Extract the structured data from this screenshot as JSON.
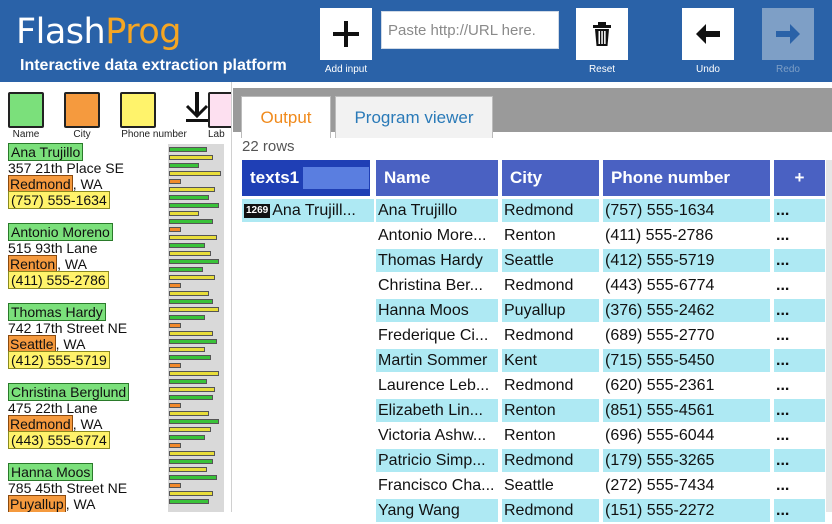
{
  "app": {
    "logo_main": "Flash",
    "logo_accent": "Prog",
    "tagline": "Interactive data extraction platform"
  },
  "toolbar": {
    "add_label": "Add input",
    "url_placeholder": "Paste http://URL here.",
    "reset_label": "Reset",
    "undo_label": "Undo",
    "redo_label": "Redo"
  },
  "legend": [
    {
      "label": "Name",
      "color": "#7be07b"
    },
    {
      "label": "City",
      "color": "#f59a3e"
    },
    {
      "label": "Phone number",
      "color": "#fff36b"
    },
    {
      "label": "Lab",
      "color": "#fde0f0"
    }
  ],
  "document": [
    {
      "name": "Ana Trujillo",
      "street": "357 21th Place SE",
      "city": "Redmond",
      "state": ", WA",
      "phone": "(757) 555-1634"
    },
    {
      "name": "Antonio Moreno",
      "street": "515 93th Lane",
      "city": "Renton",
      "state": ", WA",
      "phone": "(411) 555-2786"
    },
    {
      "name": "Thomas Hardy",
      "street": "742 17th Street NE",
      "city": "Seattle",
      "state": ", WA",
      "phone": "(412) 555-5719"
    },
    {
      "name": "Christina Berglund",
      "street": "475 22th Lane",
      "city": "Redmond",
      "state": ", WA",
      "phone": "(443) 555-6774"
    },
    {
      "name": "Hanna Moos",
      "street": "785 45th Street NE",
      "city": "Puyallup",
      "state": ", WA",
      "phone": ""
    }
  ],
  "tabs": {
    "output": "Output",
    "program": "Program viewer"
  },
  "output": {
    "rows_count": "22 rows",
    "columns": {
      "texts": "texts1",
      "name": "Name",
      "city": "City",
      "phone": "Phone number",
      "plus": "+"
    },
    "first_badge": "1269",
    "first_text": "Ana Trujill...",
    "rows": [
      {
        "name": "Ana Trujillo",
        "city": "Redmond",
        "phone": "(757) 555-1634",
        "more": "...",
        "hl": true
      },
      {
        "name": "Antonio More...",
        "city": "Renton",
        "phone": "(411) 555-2786",
        "more": "...",
        "hl": false
      },
      {
        "name": "Thomas Hardy",
        "city": "Seattle",
        "phone": "(412) 555-5719",
        "more": "...",
        "hl": true
      },
      {
        "name": "Christina Ber...",
        "city": "Redmond",
        "phone": "(443) 555-6774",
        "more": "...",
        "hl": false
      },
      {
        "name": "Hanna Moos",
        "city": "Puyallup",
        "phone": "(376) 555-2462",
        "more": "...",
        "hl": true
      },
      {
        "name": "Frederique Ci...",
        "city": "Redmond",
        "phone": "(689) 555-2770",
        "more": "...",
        "hl": false
      },
      {
        "name": "Martin Sommer",
        "city": "Kent",
        "phone": "(715) 555-5450",
        "more": "...",
        "hl": true
      },
      {
        "name": "Laurence Leb...",
        "city": "Redmond",
        "phone": "(620) 555-2361",
        "more": "...",
        "hl": false
      },
      {
        "name": "Elizabeth Lin...",
        "city": "Renton",
        "phone": "(851) 555-4561",
        "more": "...",
        "hl": true
      },
      {
        "name": "Victoria Ashw...",
        "city": "Renton",
        "phone": "(696) 555-6044",
        "more": "...",
        "hl": false
      },
      {
        "name": "Patricio Simp...",
        "city": "Redmond",
        "phone": "(179) 555-3265",
        "more": "...",
        "hl": true
      },
      {
        "name": "Francisco Cha...",
        "city": "Seattle",
        "phone": "(272) 555-7434",
        "more": "...",
        "hl": false
      },
      {
        "name": "Yang Wang",
        "city": "Redmond",
        "phone": "(151) 555-2272",
        "more": "...",
        "hl": true
      }
    ]
  },
  "colors": {
    "header_bg": "#2a62a8",
    "accent": "#f5a623",
    "row_highlight": "#aee9f3",
    "col_header": "#4a61c2"
  }
}
